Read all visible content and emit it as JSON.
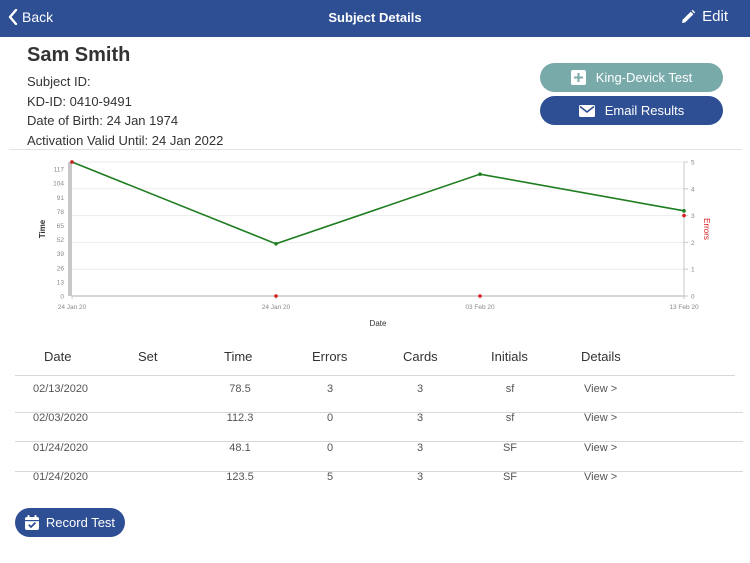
{
  "navbar": {
    "back_label": "Back",
    "title": "Subject Details",
    "edit_label": "Edit"
  },
  "subject": {
    "name": "Sam Smith",
    "subject_id_label": "Subject ID:",
    "subject_id_value": "",
    "kd_id_label": "KD-ID:",
    "kd_id_value": "0410-9491",
    "dob_label": "Date of Birth:",
    "dob_value": "24 Jan 1974",
    "activation_label": "Activation Valid Until:",
    "activation_value": "24 Jan 2022"
  },
  "actions": {
    "king_devick_label": "King-Devick Test",
    "email_label": "Email Results",
    "record_label": "Record Test"
  },
  "colors": {
    "primary": "#2f4f94",
    "secondary": "#79aaaa",
    "time_series": "#1e7d1e",
    "errors_series": "#d62020"
  },
  "chart_data": {
    "type": "line",
    "xlabel": "Date",
    "ylabel": "Time",
    "y2label": "Errors",
    "x_tick_labels": [
      "24 Jan 20",
      "24 Jan 20",
      "03 Feb 20",
      "13 Feb 20"
    ],
    "y_ticks": [
      0,
      13,
      26,
      39,
      52,
      65,
      78,
      91,
      104,
      117
    ],
    "y_range": [
      0,
      123.5
    ],
    "y2_ticks": [
      0,
      1,
      2,
      3,
      4,
      5
    ],
    "y2_range": [
      0,
      5
    ],
    "grid": true,
    "series": [
      {
        "name": "Time",
        "axis": "left",
        "values": [
          123.5,
          48.1,
          112.3,
          78.5
        ]
      },
      {
        "name": "Errors",
        "axis": "right",
        "values": [
          5,
          0,
          0,
          3
        ]
      }
    ]
  },
  "table": {
    "headers": [
      "Date",
      "Set",
      "Time",
      "Errors",
      "Cards",
      "Initials",
      "Details"
    ],
    "rows": [
      {
        "date": "02/13/2020",
        "set": "",
        "time": "78.5",
        "errors": "3",
        "cards": "3",
        "initials": "sf",
        "details": "View >"
      },
      {
        "date": "02/03/2020",
        "set": "",
        "time": "112.3",
        "errors": "0",
        "cards": "3",
        "initials": "sf",
        "details": "View >"
      },
      {
        "date": "01/24/2020",
        "set": "",
        "time": "48.1",
        "errors": "0",
        "cards": "3",
        "initials": "SF",
        "details": "View >"
      },
      {
        "date": "01/24/2020",
        "set": "",
        "time": "123.5",
        "errors": "5",
        "cards": "3",
        "initials": "SF",
        "details": "View >"
      }
    ]
  }
}
